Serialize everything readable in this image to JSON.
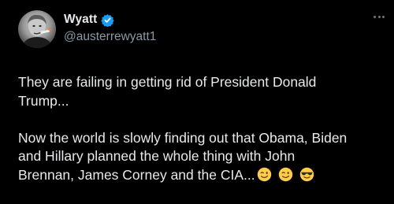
{
  "author": {
    "display_name": "Wyatt",
    "handle": "@austerrewyatt1",
    "verified": true,
    "avatar_icon": "profile-photo-icon"
  },
  "menu_icon": "more-options-icon",
  "tweet": {
    "paragraph_1": [
      "They are failing in getting rid of President Donald",
      "Trump..."
    ],
    "paragraph_2": [
      "Now the world is slowly finding out that Obama, Biden",
      "and Hillary planned the whole thing with John",
      "Brennan, James Corney and the CIA..."
    ],
    "emojis": [
      "winking-face-emoji",
      "winking-face-emoji",
      "sunglasses-face-emoji"
    ]
  },
  "colors": {
    "background": "#000000",
    "text": "#e7e9ea",
    "handle": "#8b98a5",
    "verified": "#1d9bf0"
  }
}
